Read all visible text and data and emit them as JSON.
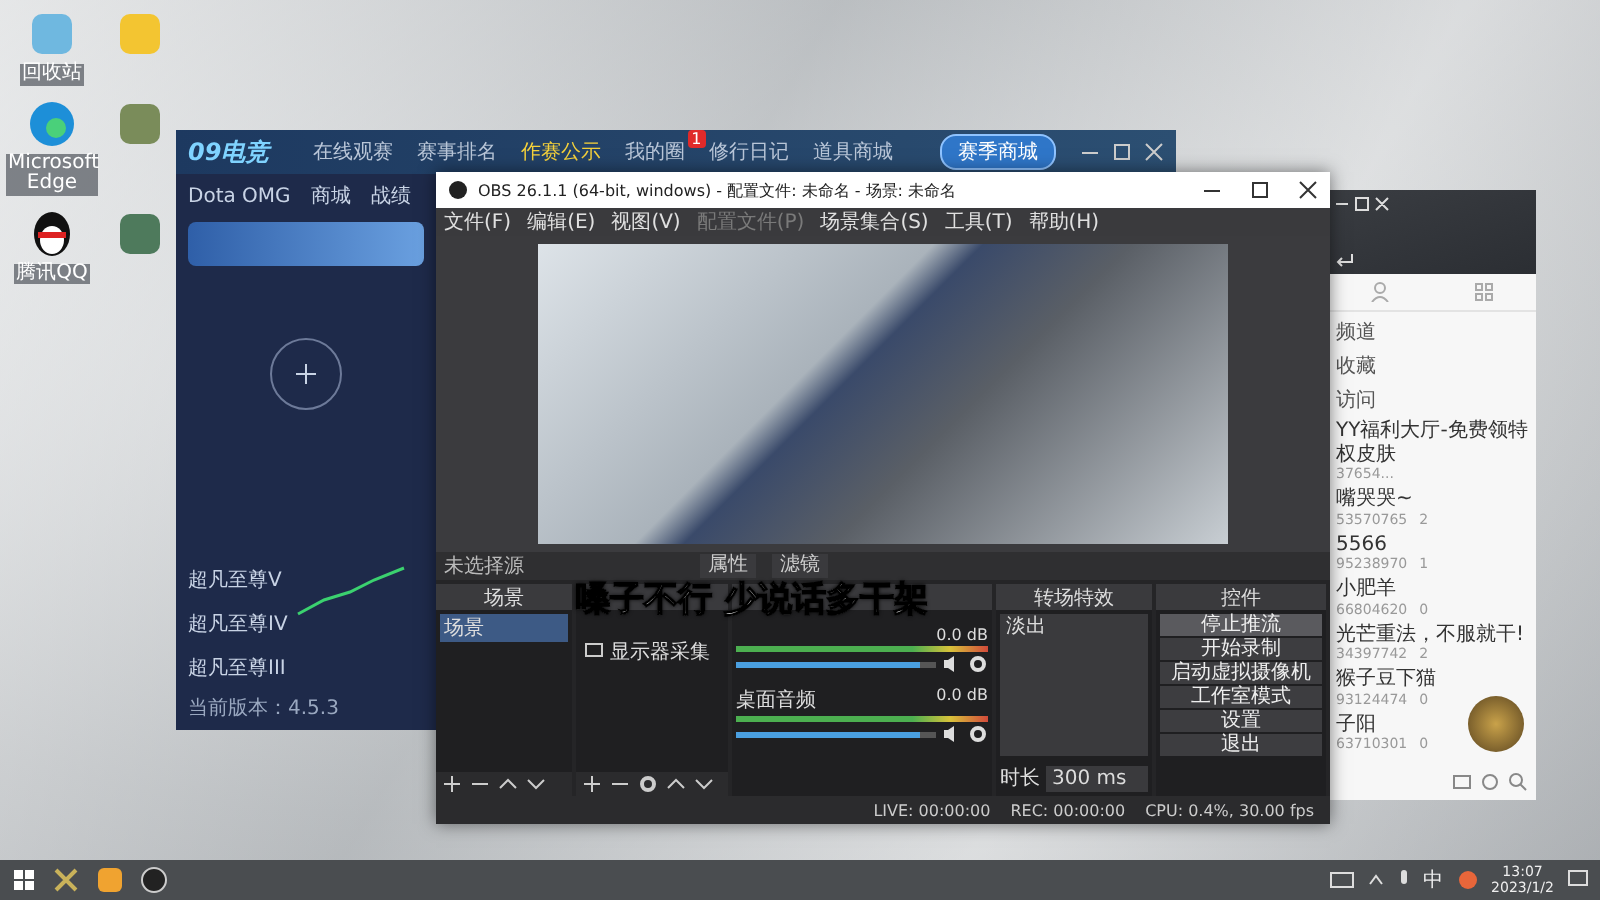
{
  "desktop_icons": [
    {
      "kind": "recycle",
      "label": "回收站"
    },
    {
      "kind": "cat"
    },
    {
      "kind": "edge",
      "label": "Microsoft Edge"
    },
    {
      "kind": "wings"
    },
    {
      "kind": "penguin",
      "label": "腾讯QQ"
    },
    {
      "kind": "shield"
    }
  ],
  "game_window": {
    "logo": "09电竞",
    "nav": [
      {
        "label": "在线观赛",
        "selected": false
      },
      {
        "label": "赛事排名",
        "selected": false
      },
      {
        "label": "作赛公示",
        "selected": true
      },
      {
        "label": "我的圈",
        "selected": false,
        "badge": "1"
      },
      {
        "label": "修行日记",
        "selected": false
      },
      {
        "label": "道具商城",
        "selected": false
      }
    ],
    "shop_button": "赛季商城",
    "subnav": [
      "Dota OMG",
      "商城",
      "战绩"
    ],
    "rank_labels": [
      "超凡至尊V",
      "超凡至尊IV",
      "超凡至尊III"
    ],
    "version": "当前版本：4.5.3"
  },
  "obs": {
    "title": "OBS 26.1.1 (64-bit, windows) - 配置文件: 未命名 - 场景: 未命名",
    "menu": [
      {
        "label": "文件(F)",
        "disabled": false
      },
      {
        "label": "编辑(E)",
        "disabled": false
      },
      {
        "label": "视图(V)",
        "disabled": false
      },
      {
        "label": "配置文件(P)",
        "disabled": true
      },
      {
        "label": "场景集合(S)",
        "disabled": false
      },
      {
        "label": "工具(T)",
        "disabled": false
      },
      {
        "label": "帮助(H)",
        "disabled": false
      }
    ],
    "source_status": "未选择源",
    "source_buttons": [
      "属性",
      "滤镜"
    ],
    "scenes": {
      "header": "场景",
      "items": [
        {
          "label": "场景",
          "selected": true
        }
      ]
    },
    "sources": {
      "items": [
        "显示器采集"
      ]
    },
    "mixer": {
      "channels": [
        {
          "reading": "0.0 dB",
          "level": 0.92
        },
        {
          "name": "桌面音频",
          "reading": "0.0 dB",
          "level": 0.92
        }
      ]
    },
    "transitions": {
      "header": "转场特效",
      "type": "淡出",
      "duration_label": "时长",
      "duration": "300 ms"
    },
    "controls": {
      "header": "控件",
      "buttons": [
        "停止推流",
        "开始录制",
        "启动虚拟摄像机",
        "工作室模式",
        "设置",
        "退出"
      ]
    },
    "caption": "嗓子不行 少说话多干架",
    "status": {
      "live": "LIVE: 00:00:00",
      "rec": "REC: 00:00:00",
      "cpu": "CPU: 0.4%, 30.00 fps"
    }
  },
  "yy_window": {
    "sections": [
      "频道",
      "收藏",
      "访问"
    ],
    "channels": [
      {
        "name": "YY福利大厅-免费领特权皮肤",
        "id": "37654..."
      },
      {
        "name": "嘴哭哭~",
        "id": "53570765",
        "count": "2"
      },
      {
        "name": "5566",
        "id": "95238970",
        "count": "1"
      },
      {
        "name": "小肥羊",
        "id": "66804620",
        "count": "0"
      },
      {
        "name": "光芒重法，不服就干!",
        "id": "34397742",
        "count": "2"
      },
      {
        "name": "猴子豆下猫",
        "id": "93124474",
        "count": "0"
      },
      {
        "name": "子阳",
        "id": "63710301",
        "count": "0"
      }
    ]
  },
  "taskbar": {
    "ime": "中",
    "time": "13:07",
    "date": "2023/1/2"
  }
}
